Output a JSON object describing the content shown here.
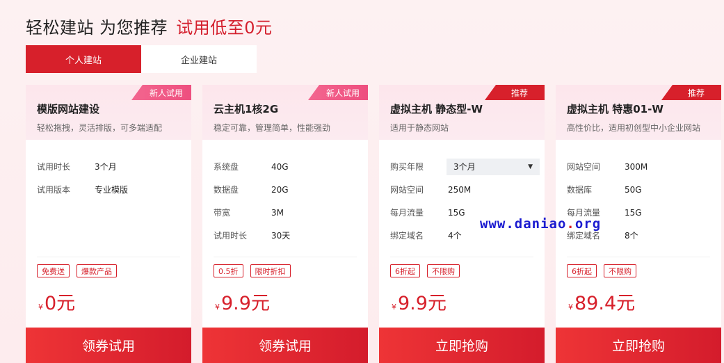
{
  "header": {
    "title": "轻松建站 为您推荐",
    "highlight": "试用低至0元"
  },
  "tabs": [
    {
      "label": "个人建站",
      "active": true
    },
    {
      "label": "企业建站",
      "active": false
    }
  ],
  "cards": [
    {
      "corner": "新人试用",
      "title": "模版网站建设",
      "subtitle": "轻松拖拽，灵活排版，可多端适配",
      "specs": [
        {
          "label": "试用时长",
          "value": "3个月"
        },
        {
          "label": "试用版本",
          "value": "专业模版"
        }
      ],
      "badges": [
        "免费送",
        "爆款产品"
      ],
      "currency": "¥",
      "price": "0元",
      "cta": "领券试用"
    },
    {
      "corner": "新人试用",
      "title": "云主机1核2G",
      "subtitle": "稳定可靠，管理简单，性能强劲",
      "specs": [
        {
          "label": "系统盘",
          "value": "40G"
        },
        {
          "label": "数据盘",
          "value": "20G"
        },
        {
          "label": "带宽",
          "value": "3M"
        },
        {
          "label": "试用时长",
          "value": "30天"
        }
      ],
      "badges": [
        "0.5折",
        "限时折扣"
      ],
      "currency": "¥",
      "price": "9.9元",
      "cta": "领券试用"
    },
    {
      "corner": "推荐",
      "title": "虚拟主机 静态型-W",
      "subtitle": "适用于静态网站",
      "select": {
        "label": "购买年限",
        "value": "3个月"
      },
      "specs": [
        {
          "label": "网站空间",
          "value": "250M"
        },
        {
          "label": "每月流量",
          "value": "15G"
        },
        {
          "label": "绑定域名",
          "value": "4个"
        }
      ],
      "badges": [
        "6折起",
        "不限购"
      ],
      "currency": "¥",
      "price": "9.9元",
      "cta": "立即抢购"
    },
    {
      "corner": "推荐",
      "title": "虚拟主机 特惠01-W",
      "subtitle": "高性价比，适用初创型中小企业网站",
      "specs": [
        {
          "label": "网站空间",
          "value": "300M"
        },
        {
          "label": "数据库",
          "value": "50G"
        },
        {
          "label": "每月流量",
          "value": "15G"
        },
        {
          "label": "绑定域名",
          "value": "8个"
        }
      ],
      "badges": [
        "6折起",
        "不限购"
      ],
      "currency": "¥",
      "price": "89.4元",
      "cta": "立即抢购"
    }
  ],
  "watermark": {
    "prefix": "www.",
    "name": "daniao",
    "dot": ".",
    "suffix": "org"
  },
  "colors": {
    "accent": "#d7202b",
    "corner_pink": "#ee4f7f",
    "background": "#fdf1f2"
  }
}
